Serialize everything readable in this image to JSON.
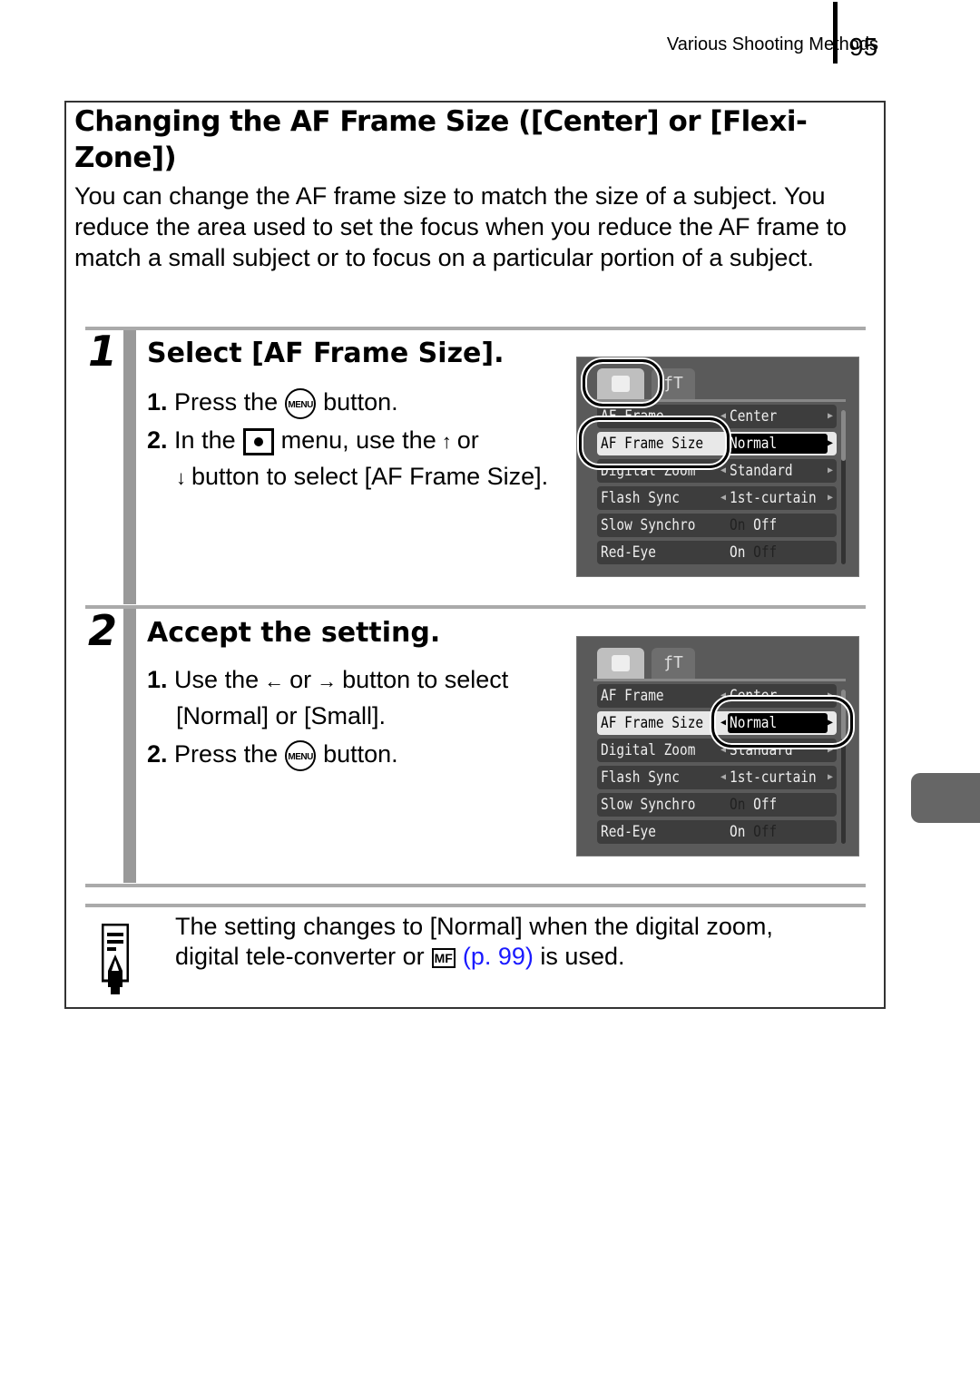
{
  "header": {
    "section": "Various Shooting Methods",
    "page_number": "95"
  },
  "title": "Changing the AF Frame Size ([Center] or [Flexi-Zone])",
  "intro": "You can change the AF frame size to match the size of a subject. You reduce the area used to set the focus when you reduce the AF frame to match a small subject or to focus on a particular portion of a subject.",
  "steps": [
    {
      "number": "1",
      "title": "Select [AF Frame Size].",
      "instructions": [
        {
          "n": "1.",
          "pre": "Press the",
          "icon": "MENU",
          "post": "button."
        },
        {
          "n": "2.",
          "pre": "In the",
          "mid": "menu, use the",
          "up": "↑",
          "or": "or",
          "down": "↓",
          "post": "button to select [AF Frame Size]."
        }
      ],
      "screen": {
        "tabs": [
          "camera",
          "settings"
        ],
        "settings_tab_glyph": "ƒΤ",
        "rows": [
          {
            "label": "AF Frame",
            "value": "Center"
          },
          {
            "label": "AF Frame Size",
            "value": "Normal"
          },
          {
            "label": "Digital Zoom",
            "value": "Standard"
          },
          {
            "label": "Flash Sync",
            "value": "1st-curtain"
          },
          {
            "label": "Slow Synchro",
            "on": "On",
            "off": "Off"
          },
          {
            "label": "Red-Eye",
            "on": "On",
            "off": "Off"
          }
        ]
      }
    },
    {
      "number": "2",
      "title": "Accept the setting.",
      "instructions": [
        {
          "n": "1.",
          "pre": "Use the",
          "left": "←",
          "or": "or",
          "right": "→",
          "post": "button to select",
          "line2": "[Normal] or [Small]."
        },
        {
          "n": "2.",
          "pre": "Press the",
          "icon": "MENU",
          "post": "button."
        }
      ]
    }
  ],
  "note": {
    "line1": "The setting changes to [Normal] when the digital zoom,",
    "line2_pre": "digital tele-converter or",
    "mf_icon": "MF",
    "link": "(p. 99)",
    "line2_post": "is used."
  },
  "colors": {
    "link": "#1a1aff",
    "screen_bg": "#5a5a5a",
    "rule": "#aaaaaa",
    "thumb_tab": "#666666"
  }
}
